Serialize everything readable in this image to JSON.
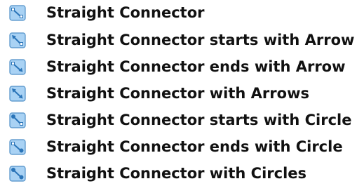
{
  "menu": {
    "items": [
      {
        "label": "Straight Connector",
        "icon": "straight-connector-icon"
      },
      {
        "label": "Straight Connector starts with Arrow",
        "icon": "straight-connector-starts-with-arrow-icon"
      },
      {
        "label": "Straight Connector ends with Arrow",
        "icon": "straight-connector-ends-with-arrow-icon"
      },
      {
        "label": "Straight Connector with Arrows",
        "icon": "straight-connector-with-arrows-icon"
      },
      {
        "label": "Straight Connector starts with Circle",
        "icon": "straight-connector-starts-with-circle-icon"
      },
      {
        "label": "Straight Connector ends with Circle",
        "icon": "straight-connector-ends-with-circle-icon"
      },
      {
        "label": "Straight Connector with Circles",
        "icon": "straight-connector-with-circles-icon"
      }
    ]
  },
  "colors": {
    "icon_fill": "#a9d2f4",
    "icon_border": "#4f8fc7",
    "icon_line": "#2a74b8",
    "text": "#111111"
  }
}
